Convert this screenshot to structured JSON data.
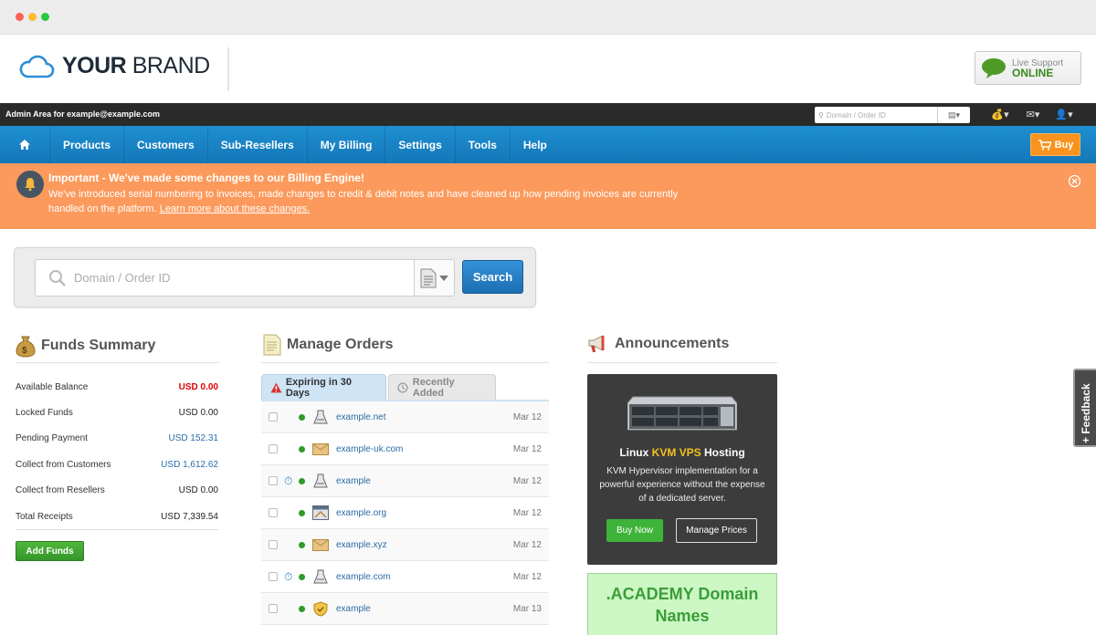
{
  "brand": {
    "name_bold": "YOUR",
    "name_light": "BRAND"
  },
  "live_support": {
    "line1": "Live Support",
    "line2": "ONLINE"
  },
  "admin_bar": {
    "label": "Admin Area for example@example.com",
    "search_placeholder": "Domain / Order ID"
  },
  "nav": {
    "items": [
      "Products",
      "Customers",
      "Sub-Resellers",
      "My Billing",
      "Settings",
      "Tools",
      "Help"
    ],
    "buy_label": "Buy"
  },
  "notice": {
    "title": "Important - We've made some changes to our Billing Engine!",
    "body": "We've introduced serial numbering to invoices, made changes to credit & debit notes and have cleaned up how pending invoices are currently handled on the platform.",
    "link": "Learn more about these changes."
  },
  "search": {
    "placeholder": "Domain / Order ID",
    "button": "Search"
  },
  "funds": {
    "title": "Funds Summary",
    "rows": [
      {
        "label": "Available Balance",
        "value": "USD 0.00"
      },
      {
        "label": "Locked Funds",
        "value": "USD 0.00"
      },
      {
        "label": "Pending Payment",
        "value": "USD 152.31"
      },
      {
        "label": "Collect from Customers",
        "value": "USD 1,612.62"
      },
      {
        "label": "Collect from Resellers",
        "value": "USD 0.00"
      },
      {
        "label": "Total Receipts",
        "value": "USD 7,339.54"
      }
    ],
    "add_button": "Add Funds",
    "colors": {
      "negative": "#dd0000",
      "link": "#2a6ca8"
    }
  },
  "orders": {
    "title": "Manage Orders",
    "tabs": [
      "Expiring in 30 Days",
      "Recently Added"
    ],
    "rows": [
      {
        "domain": "example.net",
        "date": "Mar 12",
        "icon": "hosting-icon",
        "timer": false
      },
      {
        "domain": "example-uk.com",
        "date": "Mar 12",
        "icon": "email-icon",
        "timer": false
      },
      {
        "domain": "example",
        "date": "Mar 12",
        "icon": "hosting-icon",
        "timer": true
      },
      {
        "domain": "example.org",
        "date": "Mar 12",
        "icon": "website-builder-icon",
        "timer": false
      },
      {
        "domain": "example.xyz",
        "date": "Mar 12",
        "icon": "email-icon",
        "timer": false
      },
      {
        "domain": "example.com",
        "date": "Mar 12",
        "icon": "hosting-icon",
        "timer": true
      },
      {
        "domain": "example",
        "date": "Mar 13",
        "icon": "ssl-shield-icon",
        "timer": false
      }
    ]
  },
  "announcements": {
    "title": "Announcements",
    "card": {
      "head_pre": "Linux ",
      "head_highlight": "KVM VPS",
      "head_post": " Hosting",
      "body": "KVM Hypervisor implementation for a powerful experience without the expense of a dedicated server.",
      "buy_now": "Buy Now",
      "manage_prices": "Manage Prices"
    },
    "academy": ".ACADEMY Domain Names"
  },
  "feedback": {
    "label": "+ Feedback"
  }
}
